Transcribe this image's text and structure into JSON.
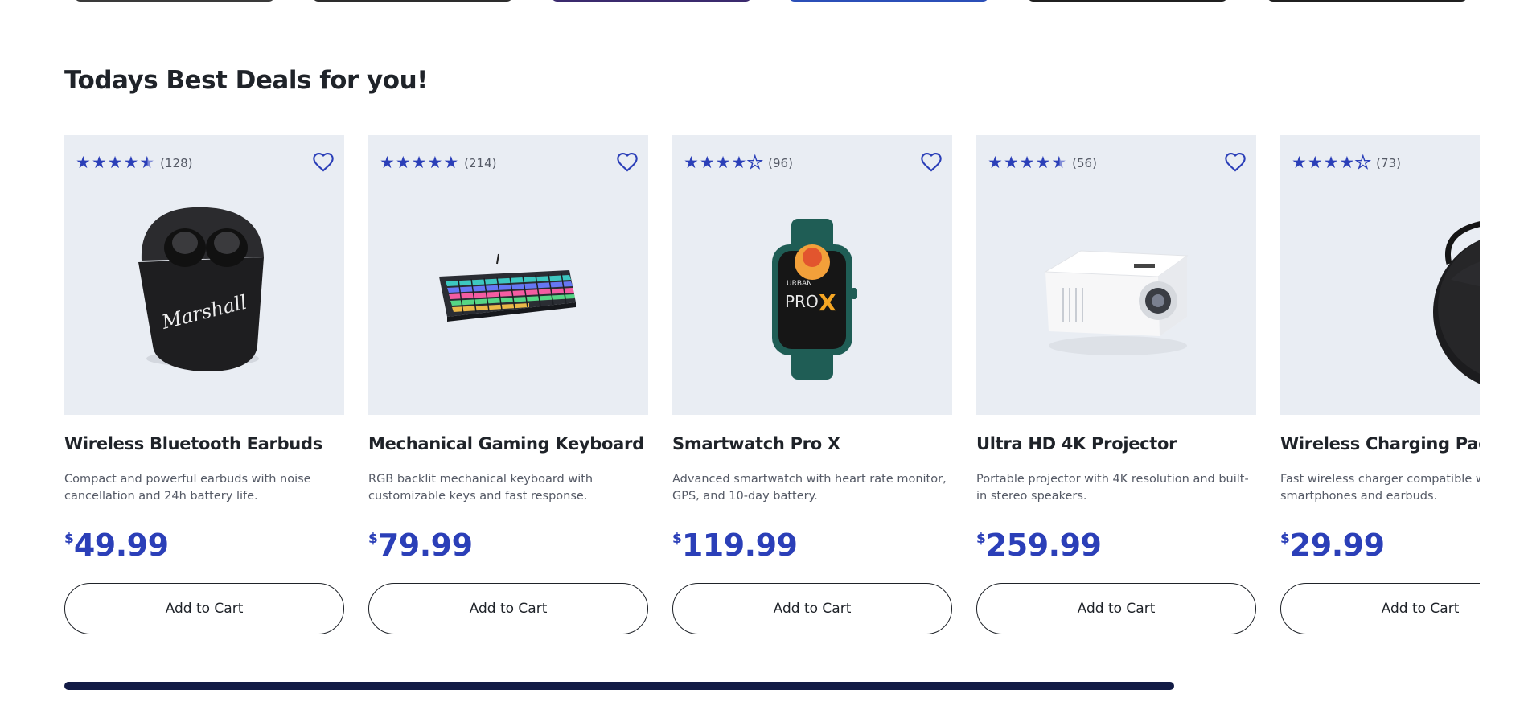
{
  "section": {
    "title": "Todays Best Deals for you!"
  },
  "colors": {
    "accent": "#2b3fb8",
    "card_bg": "#e9edf3",
    "scrollbar": "#121b45"
  },
  "products": [
    {
      "name": "Wireless Bluetooth Earbuds",
      "description": "Compact and powerful earbuds with noise cancellation and 24h battery life.",
      "currency": "$",
      "price": "49.99",
      "rating": 4.5,
      "review_count": "(128)",
      "cart_label": "Add to Cart",
      "image_icon": "earbuds-case-image"
    },
    {
      "name": "Mechanical Gaming Keyboard",
      "description": "RGB backlit mechanical keyboard with customizable keys and fast response.",
      "currency": "$",
      "price": "79.99",
      "rating": 5,
      "review_count": "(214)",
      "cart_label": "Add to Cart",
      "image_icon": "keyboard-image"
    },
    {
      "name": "Smartwatch Pro X",
      "description": "Advanced smartwatch with heart rate monitor, GPS, and 10-day battery.",
      "currency": "$",
      "price": "119.99",
      "rating": 4,
      "review_count": "(96)",
      "cart_label": "Add to Cart",
      "image_icon": "smartwatch-image",
      "image_text": {
        "brand": "URBAN",
        "model_a": "PRO",
        "model_b": "X"
      }
    },
    {
      "name": "Ultra HD 4K Projector",
      "description": "Portable projector with 4K resolution and built-in stereo speakers.",
      "currency": "$",
      "price": "259.99",
      "rating": 4.5,
      "review_count": "(56)",
      "cart_label": "Add to Cart",
      "image_icon": "projector-image"
    },
    {
      "name": "Wireless Charging Pad",
      "description": "Fast wireless charger compatible with smartphones and earbuds.",
      "currency": "$",
      "price": "29.99",
      "rating": 4,
      "review_count": "(73)",
      "cart_label": "Add to Cart",
      "image_icon": "charging-pad-image"
    }
  ],
  "carousel": {
    "scroll_progress": 0.78
  }
}
